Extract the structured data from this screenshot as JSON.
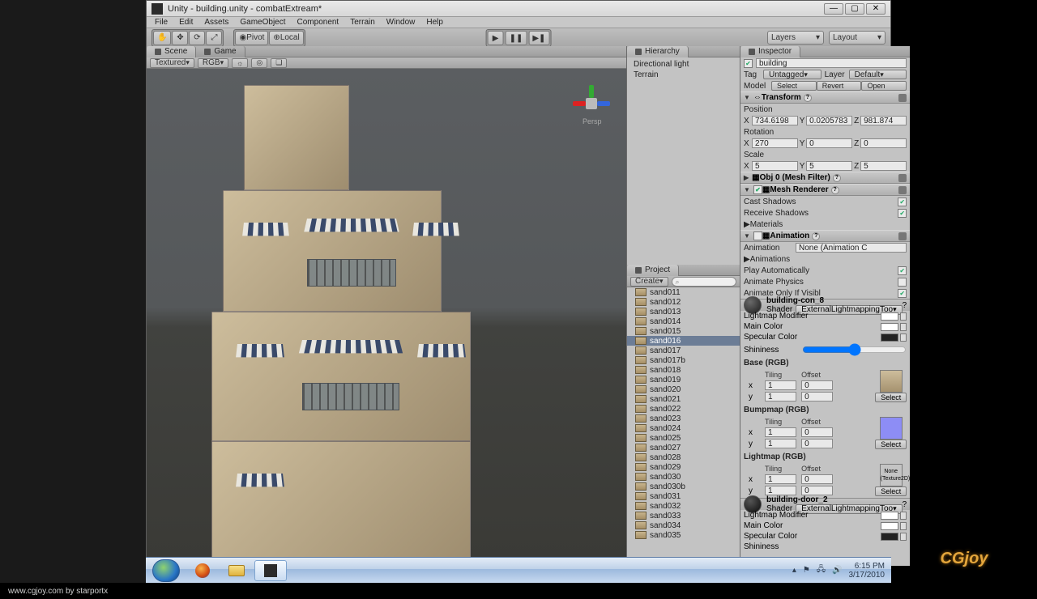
{
  "window_title": "Unity - building.unity - combatExtream*",
  "menu": [
    "File",
    "Edit",
    "Assets",
    "GameObject",
    "Component",
    "Terrain",
    "Window",
    "Help"
  ],
  "pivot_buttons": {
    "pivot": "Pivot",
    "local": "Local"
  },
  "layers_label": "Layers",
  "layout_label": "Layout",
  "scene_tab": "Scene",
  "game_tab": "Game",
  "scene_ctrl": {
    "shade": "Textured",
    "rgb": "RGB"
  },
  "gizmo_label": "Persp",
  "hierarchy": {
    "title": "Hierarchy",
    "items": [
      "Directional light",
      "Terrain"
    ]
  },
  "project": {
    "title": "Project",
    "create": "Create",
    "search": "",
    "items": [
      "sand011",
      "sand012",
      "sand013",
      "sand014",
      "sand015",
      "sand016",
      "sand017",
      "sand017b",
      "sand018",
      "sand019",
      "sand020",
      "sand021",
      "sand022",
      "sand023",
      "sand024",
      "sand025",
      "sand027",
      "sand028",
      "sand029",
      "sand030",
      "sand030b",
      "sand031",
      "sand032",
      "sand033",
      "sand034",
      "sand035"
    ],
    "selected": "sand016"
  },
  "inspector": {
    "title": "Inspector",
    "obj_name": "building",
    "tag_label": "Tag",
    "tag_value": "Untagged",
    "layer_label": "Layer",
    "layer_value": "Default",
    "model_label": "Model",
    "select": "Select",
    "revert": "Revert",
    "open": "Open",
    "transform": {
      "title": "Transform",
      "position": "Position",
      "rotation": "Rotation",
      "scale": "Scale",
      "px": "734.6198",
      "py": "0.0205783",
      "pz": "981.874",
      "rx": "270",
      "ry": "0",
      "rz": "0",
      "sx": "5",
      "sy": "5",
      "sz": "5"
    },
    "mesh_filter": "Obj 0 (Mesh Filter)",
    "mesh_renderer": {
      "title": "Mesh Renderer",
      "cast": "Cast Shadows",
      "recv": "Receive Shadows"
    },
    "materials": "Materials",
    "animation": {
      "title": "Animation",
      "clip_label": "Animation",
      "clip_value": "None (Animation C",
      "animations": "Animations",
      "play": "Play Automatically",
      "phys": "Animate Physics",
      "vis": "Animate Only If Visibl"
    },
    "mat1": {
      "name": "building-con_8",
      "shader_label": "Shader",
      "shader": "ExternalLightmappingToo",
      "lm": "Lightmap Modifier",
      "mc": "Main Color",
      "sc": "Specular Color",
      "sh": "Shininess",
      "base": "Base (RGB)",
      "bump": "Bumpmap (RGB)",
      "light": "Lightmap (RGB)",
      "tiling": "Tiling",
      "offset": "Offset",
      "select": "Select",
      "none": "None\n(Texture2D)"
    },
    "mat2": {
      "name": "building-door_2",
      "shader": "ExternalLightmappingToo",
      "lm": "Lightmap Modifier",
      "mc": "Main Color",
      "sc": "Specular Color",
      "sh": "Shininess"
    }
  },
  "tray": {
    "time": "6:15 PM",
    "date": "3/17/2010"
  },
  "footer": "www.cgjoy.com by starportx",
  "logo": "CGjoy"
}
